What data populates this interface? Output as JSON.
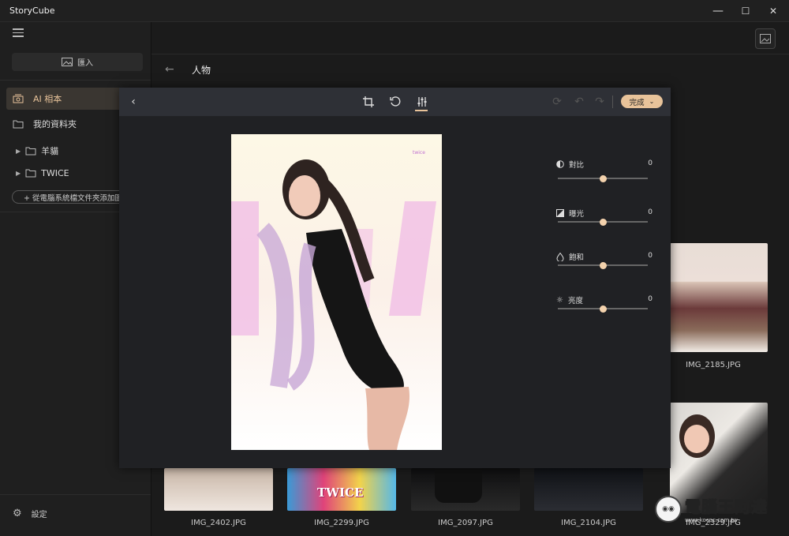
{
  "window": {
    "title": "StoryCube",
    "minimize_glyph": "—",
    "maximize_glyph": "☐",
    "close_glyph": "✕"
  },
  "sidebar": {
    "import_label": "匯入",
    "items": [
      {
        "label": "AI 相本",
        "icon": "ai-album-icon",
        "active": true
      },
      {
        "label": "我的資料夾",
        "icon": "folder-icon",
        "active": false
      }
    ],
    "tree": [
      {
        "label": "羊貓",
        "icon": "folder-icon"
      },
      {
        "label": "TWICE",
        "icon": "folder-icon"
      }
    ],
    "add_folder_label": "+ 從電腦系統檔文件夾添加圖片",
    "settings_label": "設定"
  },
  "main": {
    "section_title": "人物",
    "thumbnails": [
      {
        "name": "IMG_2185.JPG"
      },
      {
        "name": "IMG_2402.JPG"
      },
      {
        "name": "IMG_2299.JPG"
      },
      {
        "name": "IMG_2097.JPG"
      },
      {
        "name": "IMG_2104.JPG"
      },
      {
        "name": "IMG_2329.JPG"
      }
    ],
    "twice_text": "TWICE"
  },
  "editor": {
    "tools": [
      "crop-icon",
      "rotate-icon",
      "adjust-icon"
    ],
    "done_label": "完成",
    "photo_tag": "twice",
    "adjustments": [
      {
        "label": "對比",
        "value": "0",
        "icon": "contrast-icon",
        "fraction": 0.5
      },
      {
        "label": "曝光",
        "value": "0",
        "icon": "exposure-icon",
        "fraction": 0.5
      },
      {
        "label": "飽和",
        "value": "0",
        "icon": "saturation-icon",
        "fraction": 0.5
      },
      {
        "label": "亮度",
        "value": "0",
        "icon": "brightness-icon",
        "fraction": 0.5
      }
    ]
  },
  "watermark": {
    "text": "電腦王阿達",
    "url": "www.kocpc.com.tw"
  },
  "colors": {
    "accent": "#e8c39a",
    "toolbar": "#2e3036",
    "background": "#1b1b1b"
  }
}
